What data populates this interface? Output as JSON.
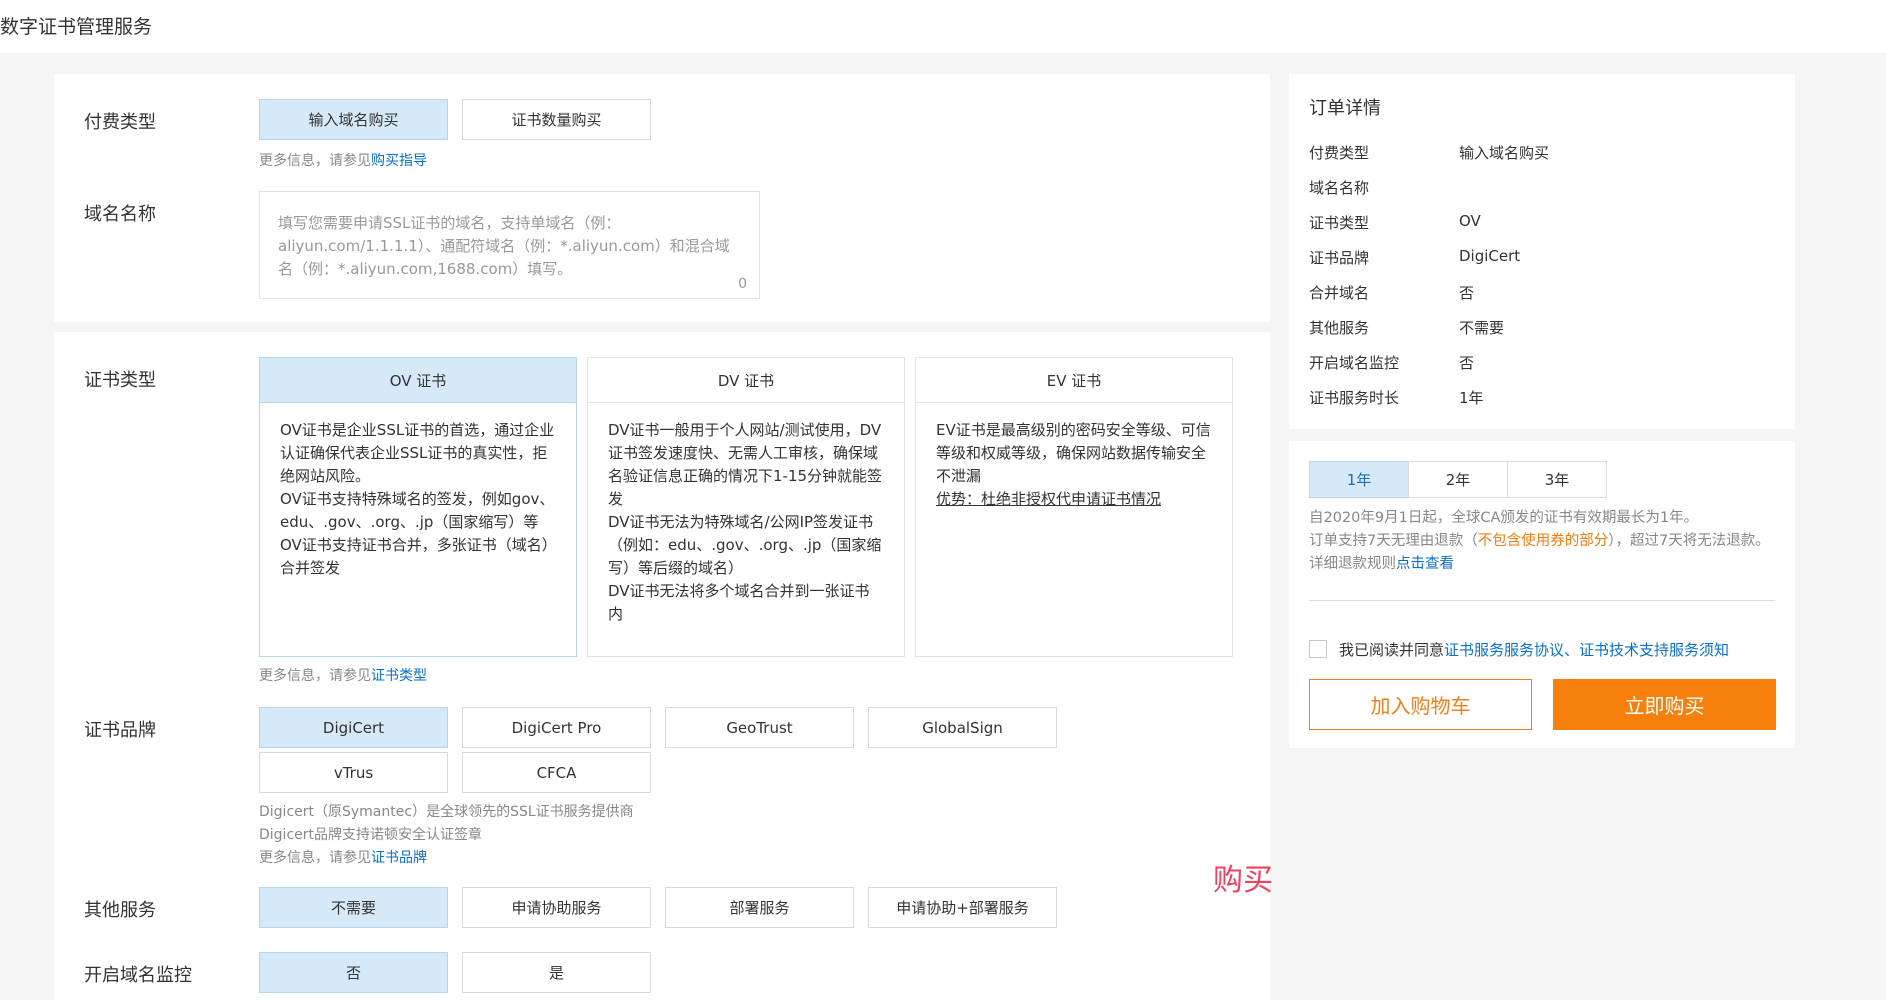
{
  "page": {
    "title": "数字证书管理服务"
  },
  "payment": {
    "label": "付费类型",
    "options": [
      "输入域名购买",
      "证书数量购买"
    ],
    "hint_prefix": "更多信息，请参见",
    "hint_link": "购买指导"
  },
  "domain": {
    "label": "域名名称",
    "placeholder": "填写您需要申请SSL证书的域名，支持单域名（例：aliyun.com/1.1.1.1）、通配符域名（例：*.aliyun.com）和混合域名（例：*.aliyun.com,1688.com）填写。",
    "count": "0"
  },
  "cert_type": {
    "label": "证书类型",
    "cards": [
      {
        "title": "OV 证书",
        "lines": [
          "OV证书是企业SSL证书的首选，通过企业认证确保代表企业SSL证书的真实性，拒绝网站风险。",
          "OV证书支持特殊域名的签发，例如gov、edu、.gov、.org、.jp（国家缩写）等",
          "OV证书支持证书合并，多张证书（域名）合并签发"
        ]
      },
      {
        "title": "DV 证书",
        "lines": [
          "DV证书一般用于个人网站/测试使用，DV证书签发速度快、无需人工审核，确保域名验证信息正确的情况下1-15分钟就能签发",
          "DV证书无法为特殊域名/公网IP签发证书（例如：edu、.gov、.org、.jp（国家缩写）等后缀的域名）",
          "DV证书无法将多个域名合并到一张证书内"
        ]
      },
      {
        "title": "EV 证书",
        "lines": [
          "EV证书是最高级别的密码安全等级、可信等级和权威等级，确保网站数据传输安全不泄漏"
        ],
        "underline": "优势：杜绝非授权代申请证书情况"
      }
    ],
    "hint_prefix": "更多信息，请参见",
    "hint_link": "证书类型"
  },
  "brand": {
    "label": "证书品牌",
    "options": [
      "DigiCert",
      "DigiCert Pro",
      "GeoTrust",
      "GlobalSign",
      "vTrus",
      "CFCA"
    ],
    "desc1": "Digicert（原Symantec）是全球领先的SSL证书服务提供商",
    "desc2": "Digicert品牌支持诺顿安全认证签章",
    "hint_prefix": "更多信息，请参见",
    "hint_link": "证书品牌"
  },
  "other_service": {
    "label": "其他服务",
    "options": [
      "不需要",
      "申请协助服务",
      "部署服务",
      "申请协助+部署服务"
    ]
  },
  "monitor": {
    "label": "开启域名监控",
    "options": [
      "否",
      "是"
    ]
  },
  "annotation": "购买",
  "order": {
    "title": "订单详情",
    "rows": [
      {
        "k": "付费类型",
        "v": "输入域名购买"
      },
      {
        "k": "域名名称",
        "v": ""
      },
      {
        "k": "证书类型",
        "v": "OV"
      },
      {
        "k": "证书品牌",
        "v": "DigiCert"
      },
      {
        "k": "合并域名",
        "v": "否"
      },
      {
        "k": "其他服务",
        "v": "不需要"
      },
      {
        "k": "开启域名监控",
        "v": "否"
      },
      {
        "k": "证书服务时长",
        "v": "1年"
      }
    ]
  },
  "duration": {
    "options": [
      "1年",
      "2年",
      "3年"
    ],
    "note1": "自2020年9月1日起，全球CA颁发的证书有效期最长为1年。",
    "note2_a": "订单支持7天无理由退款（",
    "note2_warn": "不包含使用券的部分",
    "note2_b": "），超过7天将无法退款。详细退款规则",
    "note2_link": "点击查看",
    "agree_prefix": "我已阅读并同意",
    "agree_link1": "证书服务服务协议",
    "agree_sep": "、",
    "agree_link2": "证书技术支持服务须知",
    "cart_button": "加入购物车",
    "buy_button": "立即购买"
  },
  "colors": {
    "selected_bg": "#d6e9f8",
    "link": "#0a6fc7",
    "orange": "#f7800d",
    "annotation_red": "#f2415e"
  }
}
